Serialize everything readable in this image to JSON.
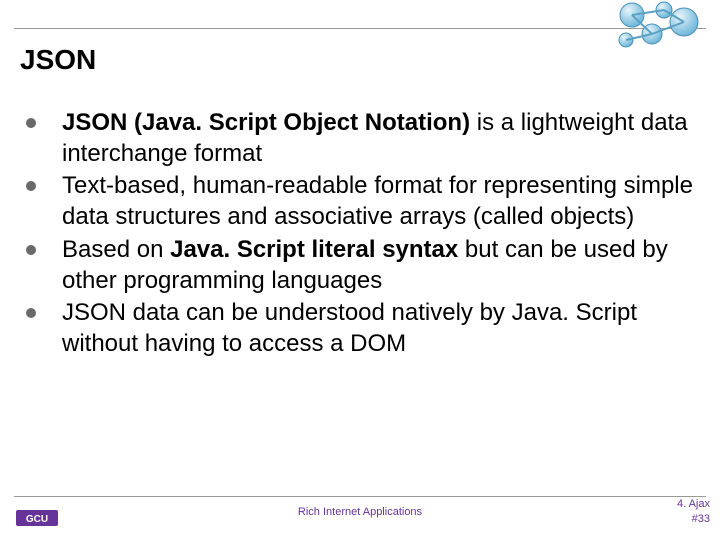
{
  "title": "JSON",
  "bullets": [
    {
      "html": "<span class='strong'>JSON (Java. Script Object Notation)</span> is a lightweight data interchange format"
    },
    {
      "html": "Text-based, human-readable format for representing simple data structures and associative arrays (called objects)"
    },
    {
      "html": "Based on <span class='strong'>Java. Script literal syntax</span> but can be used by other programming languages"
    },
    {
      "html": "JSON data can be understood natively by Java. Script without having to access a DOM"
    }
  ],
  "footer": {
    "center": "Rich Internet Applications",
    "right_line1": "4. Ajax",
    "right_line2": "#33"
  }
}
